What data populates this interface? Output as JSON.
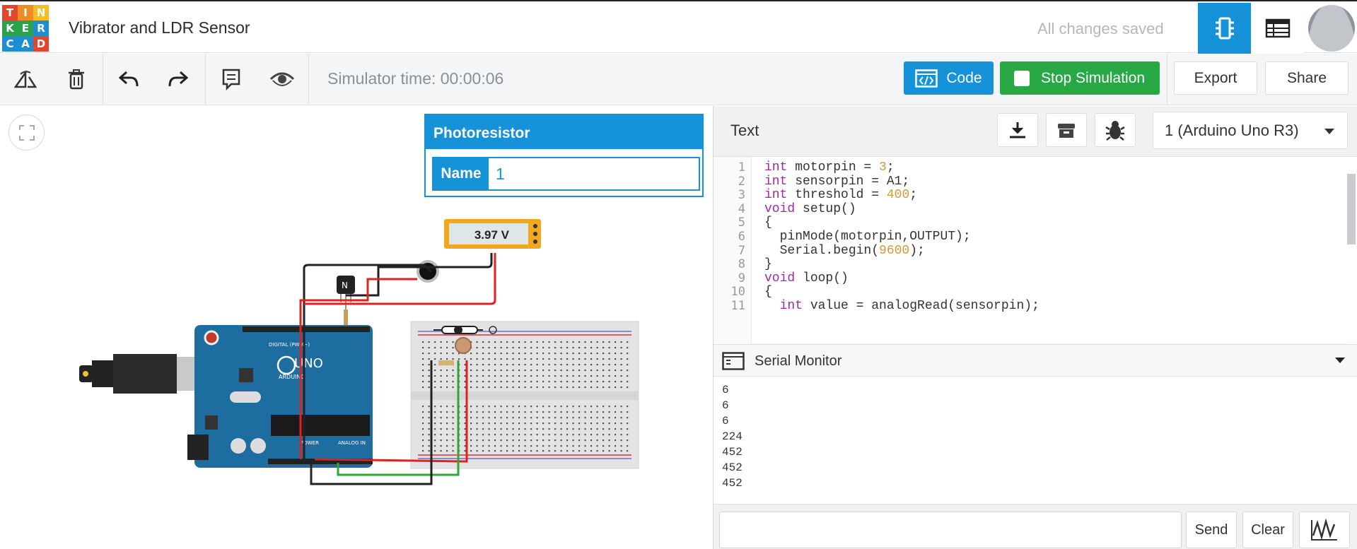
{
  "logo": {
    "letters": [
      "T",
      "I",
      "N",
      "K",
      "E",
      "R",
      "C",
      "A",
      "D"
    ],
    "colors": [
      "#e2462b",
      "#ef8b27",
      "#f4c01e",
      "#2aa24b",
      "#2aa24b",
      "#1d8ed1",
      "#1d8ed1",
      "#1d8ed1",
      "#e2462b"
    ]
  },
  "header": {
    "project_title": "Vibrator and LDR Sensor",
    "save_status": "All changes saved",
    "circuit_view_icon": "circuit-view-icon",
    "component_list_icon": "component-list-icon",
    "avatar_icon": "user-avatar-icon"
  },
  "toolbar": {
    "icons": [
      "rotate-icon",
      "trash-icon",
      "undo-icon",
      "redo-icon",
      "notes-icon",
      "visibility-icon"
    ],
    "simulator_time": "Simulator time: 00:00:06",
    "code_label": "Code",
    "stop_label": "Stop Simulation",
    "export_label": "Export",
    "share_label": "Share",
    "colors": {
      "code": "#1592d8",
      "stop": "#28a745"
    }
  },
  "canvas": {
    "inspector": {
      "title": "Photoresistor",
      "name_label": "Name",
      "name_value": "1"
    },
    "multimeter_reading": "3.97 V",
    "transistor_label": "N",
    "arduino": {
      "brand": "ARDUINO",
      "model": "UNO",
      "digital": "DIGITAL (PWM~)",
      "power": "POWER",
      "analog": "ANALOG IN"
    }
  },
  "code_panel": {
    "mode_label": "Text",
    "download_icon": "download-icon",
    "library_icon": "library-icon",
    "debug_icon": "bug-icon",
    "device": "1 (Arduino Uno R3)",
    "line_numbers": [
      "1",
      "2",
      "3",
      "4",
      "5",
      "6",
      "7",
      "8",
      "9",
      "10",
      "11"
    ],
    "lines": [
      {
        "kw": "int",
        "rest": " motorpin = ",
        "num": "3",
        "end": ";"
      },
      {
        "kw": "int",
        "rest": " sensorpin = A1;",
        "num": "",
        "end": ""
      },
      {
        "kw": "int",
        "rest": " threshold = ",
        "num": "400",
        "end": ";"
      },
      {
        "kw": "void",
        "rest": " setup()",
        "num": "",
        "end": ""
      },
      {
        "kw": "",
        "rest": "{",
        "num": "",
        "end": ""
      },
      {
        "kw": "",
        "rest": "  pinMode(motorpin,OUTPUT);",
        "num": "",
        "end": ""
      },
      {
        "kw": "",
        "rest": "  Serial.begin(",
        "num": "9600",
        "end": ");"
      },
      {
        "kw": "",
        "rest": "}",
        "num": "",
        "end": ""
      },
      {
        "kw": "void",
        "rest": " loop()",
        "num": "",
        "end": ""
      },
      {
        "kw": "",
        "rest": "{",
        "num": "",
        "end": ""
      },
      {
        "kw": "  int",
        "rest": " value = analogRead(sensorpin);",
        "num": "",
        "end": ""
      }
    ]
  },
  "serial_monitor": {
    "title": "Serial Monitor",
    "output": [
      "6",
      "6",
      "6",
      "224",
      "452",
      "452",
      "452"
    ],
    "input_value": "",
    "send_label": "Send",
    "clear_label": "Clear",
    "graph_icon": "graph-icon"
  }
}
